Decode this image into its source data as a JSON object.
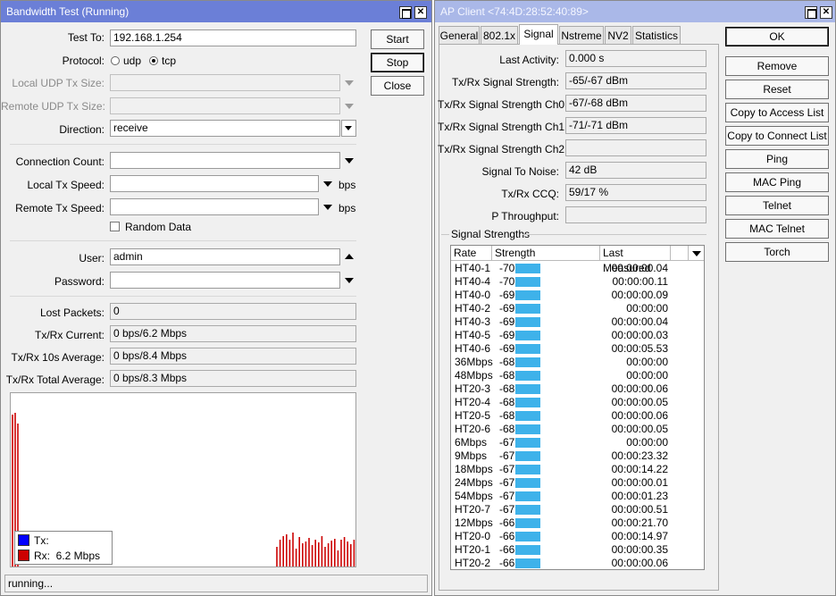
{
  "bw": {
    "title": "Bandwidth Test (Running)",
    "test_to_label": "Test To:",
    "test_to_value": "192.168.1.254",
    "protocol_label": "Protocol:",
    "proto_udp": "udp",
    "proto_tcp": "tcp",
    "local_udp_label": "Local UDP Tx Size:",
    "remote_udp_label": "Remote UDP Tx Size:",
    "direction_label": "Direction:",
    "direction_value": "receive",
    "conn_count_label": "Connection Count:",
    "local_tx_label": "Local Tx Speed:",
    "remote_tx_label": "Remote Tx Speed:",
    "bps": "bps",
    "random_data": "Random Data",
    "user_label": "User:",
    "user_value": "admin",
    "password_label": "Password:",
    "lost_packets_label": "Lost Packets:",
    "lost_packets_value": "0",
    "current_label": "Tx/Rx Current:",
    "current_value": "0 bps/6.2 Mbps",
    "avg10_label": "Tx/Rx 10s Average:",
    "avg10_value": "0 bps/8.4 Mbps",
    "total_label": "Tx/Rx Total Average:",
    "total_value": "0 bps/8.3 Mbps",
    "start": "Start",
    "stop": "Stop",
    "close": "Close",
    "legend_tx": "Tx:",
    "legend_rx": "Rx:  6.2 Mbps",
    "status": "running...",
    "colors": {
      "tx": "#0000ff",
      "rx": "#cc0000"
    }
  },
  "ap": {
    "title": "AP Client <74:4D:28:52:40:89>",
    "tabs": [
      "General",
      "802.1x",
      "Signal",
      "Nstreme",
      "NV2",
      "Statistics"
    ],
    "fields": [
      {
        "label": "Last Activity:",
        "value": "0.000 s"
      },
      {
        "label": "Tx/Rx Signal Strength:",
        "value": "-65/-67 dBm"
      },
      {
        "label": "Tx/Rx Signal Strength Ch0:",
        "value": "-67/-68 dBm"
      },
      {
        "label": "Tx/Rx Signal Strength Ch1:",
        "value": "-71/-71 dBm"
      },
      {
        "label": "Tx/Rx Signal Strength Ch2:",
        "value": ""
      },
      {
        "label": "Signal To Noise:",
        "value": "42 dB"
      },
      {
        "label": "Tx/Rx CCQ:",
        "value": "59/17 %"
      },
      {
        "label": "P Throughput:",
        "value": ""
      }
    ],
    "group_title": "Signal Strengths",
    "columns": [
      "Rate",
      "Strength",
      "Last Measured"
    ],
    "rows": [
      {
        "rate": "HT40-1",
        "strength": "-70",
        "last": "00:00:00.04"
      },
      {
        "rate": "HT40-4",
        "strength": "-70",
        "last": "00:00:00.11"
      },
      {
        "rate": "HT40-0",
        "strength": "-69",
        "last": "00:00:00.09"
      },
      {
        "rate": "HT40-2",
        "strength": "-69",
        "last": "00:00:00"
      },
      {
        "rate": "HT40-3",
        "strength": "-69",
        "last": "00:00:00.04"
      },
      {
        "rate": "HT40-5",
        "strength": "-69",
        "last": "00:00:00.03"
      },
      {
        "rate": "HT40-6",
        "strength": "-69",
        "last": "00:00:05.53"
      },
      {
        "rate": "36Mbps",
        "strength": "-68",
        "last": "00:00:00"
      },
      {
        "rate": "48Mbps",
        "strength": "-68",
        "last": "00:00:00"
      },
      {
        "rate": "HT20-3",
        "strength": "-68",
        "last": "00:00:00.06"
      },
      {
        "rate": "HT20-4",
        "strength": "-68",
        "last": "00:00:00.05"
      },
      {
        "rate": "HT20-5",
        "strength": "-68",
        "last": "00:00:00.06"
      },
      {
        "rate": "HT20-6",
        "strength": "-68",
        "last": "00:00:00.05"
      },
      {
        "rate": "6Mbps",
        "strength": "-67",
        "last": "00:00:00"
      },
      {
        "rate": "9Mbps",
        "strength": "-67",
        "last": "00:00:23.32"
      },
      {
        "rate": "18Mbps",
        "strength": "-67",
        "last": "00:00:14.22"
      },
      {
        "rate": "24Mbps",
        "strength": "-67",
        "last": "00:00:00.01"
      },
      {
        "rate": "54Mbps",
        "strength": "-67",
        "last": "00:00:01.23"
      },
      {
        "rate": "HT20-7",
        "strength": "-67",
        "last": "00:00:00.51"
      },
      {
        "rate": "12Mbps",
        "strength": "-66",
        "last": "00:00:21.70"
      },
      {
        "rate": "HT20-0",
        "strength": "-66",
        "last": "00:00:14.97"
      },
      {
        "rate": "HT20-1",
        "strength": "-66",
        "last": "00:00:00.35"
      },
      {
        "rate": "HT20-2",
        "strength": "-66",
        "last": "00:00:00.06"
      }
    ],
    "buttons": [
      "OK",
      "Remove",
      "Reset",
      "Copy to Access List",
      "Copy to Connect List",
      "Ping",
      "MAC Ping",
      "Telnet",
      "MAC Telnet",
      "Torch"
    ],
    "bar_color": "#3eb2ea"
  }
}
